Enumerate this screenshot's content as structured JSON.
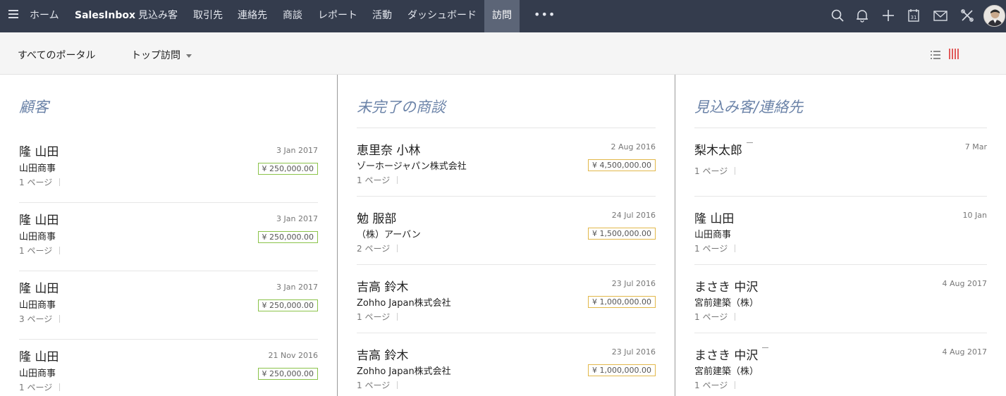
{
  "nav": {
    "items": [
      {
        "label": "ホーム"
      },
      {
        "label": "SalesInbox"
      },
      {
        "label": "見込み客"
      },
      {
        "label": "取引先"
      },
      {
        "label": "連絡先"
      },
      {
        "label": "商談"
      },
      {
        "label": "レポート"
      },
      {
        "label": "活動"
      },
      {
        "label": "ダッシュボード"
      },
      {
        "label": "訪問"
      }
    ],
    "more_label": "•••",
    "icons": [
      "search-icon",
      "bell-icon",
      "plus-icon",
      "calendar-icon",
      "mail-icon",
      "tools-icon"
    ],
    "calendar_day": "31"
  },
  "subheader": {
    "portal_label": "すべてのポータル",
    "filter_label": "トップ訪問"
  },
  "colors": {
    "nav_bg": "#343c4d",
    "nav_active": "#5c6577",
    "title": "#6b83a8",
    "amount_green_border": "#8bc34a",
    "amount_yellow_border": "#e2b84a",
    "kanban_icon": "#e15a5a"
  },
  "columns": [
    {
      "title": "顧客",
      "cards": [
        {
          "name": "隆 山田",
          "company": "山田商事",
          "pages": "1 ページ",
          "date": "3 Jan 2017",
          "amount": "¥ 250,000.00"
        },
        {
          "name": "隆 山田",
          "company": "山田商事",
          "pages": "1 ページ",
          "date": "3 Jan 2017",
          "amount": "¥ 250,000.00"
        },
        {
          "name": "隆 山田",
          "company": "山田商事",
          "pages": "3 ページ",
          "date": "3 Jan 2017",
          "amount": "¥ 250,000.00"
        },
        {
          "name": "隆 山田",
          "company": "山田商事",
          "pages": "1 ページ",
          "date": "21 Nov 2016",
          "amount": "¥ 250,000.00"
        }
      ]
    },
    {
      "title": "未完了の商談",
      "cards": [
        {
          "name": "恵里奈 小林",
          "company": "ゾーホージャパン株式会社",
          "pages": "1 ページ",
          "date": "2 Aug 2016",
          "amount": "¥ 4,500,000.00"
        },
        {
          "name": "勉 服部",
          "company": "（株）アーバン",
          "pages": "2 ページ",
          "date": "24 Jul 2016",
          "amount": "¥ 1,500,000.00"
        },
        {
          "name": "吉高 鈴木",
          "company": "Zohho Japan株式会社",
          "pages": "1 ページ",
          "date": "23 Jul 2016",
          "amount": "¥ 1,000,000.00"
        },
        {
          "name": "吉高 鈴木",
          "company": "Zohho Japan株式会社",
          "pages": "1 ページ",
          "date": "23 Jul 2016",
          "amount": "¥ 1,000,000.00"
        }
      ]
    },
    {
      "title": "見込み客/連絡先",
      "cards": [
        {
          "name": "梨木太郎",
          "company": "",
          "pages": "1 ページ",
          "date": "7 Mar"
        },
        {
          "name": "隆 山田",
          "company": "山田商事",
          "pages": "1 ページ",
          "date": "10 Jan"
        },
        {
          "name": "まさき 中沢",
          "company": "宮前建築（株）",
          "pages": "1 ページ",
          "date": "4 Aug 2017"
        },
        {
          "name": "まさき 中沢",
          "company": "宮前建築（株）",
          "pages": "1 ページ",
          "date": "4 Aug 2017"
        }
      ]
    }
  ]
}
